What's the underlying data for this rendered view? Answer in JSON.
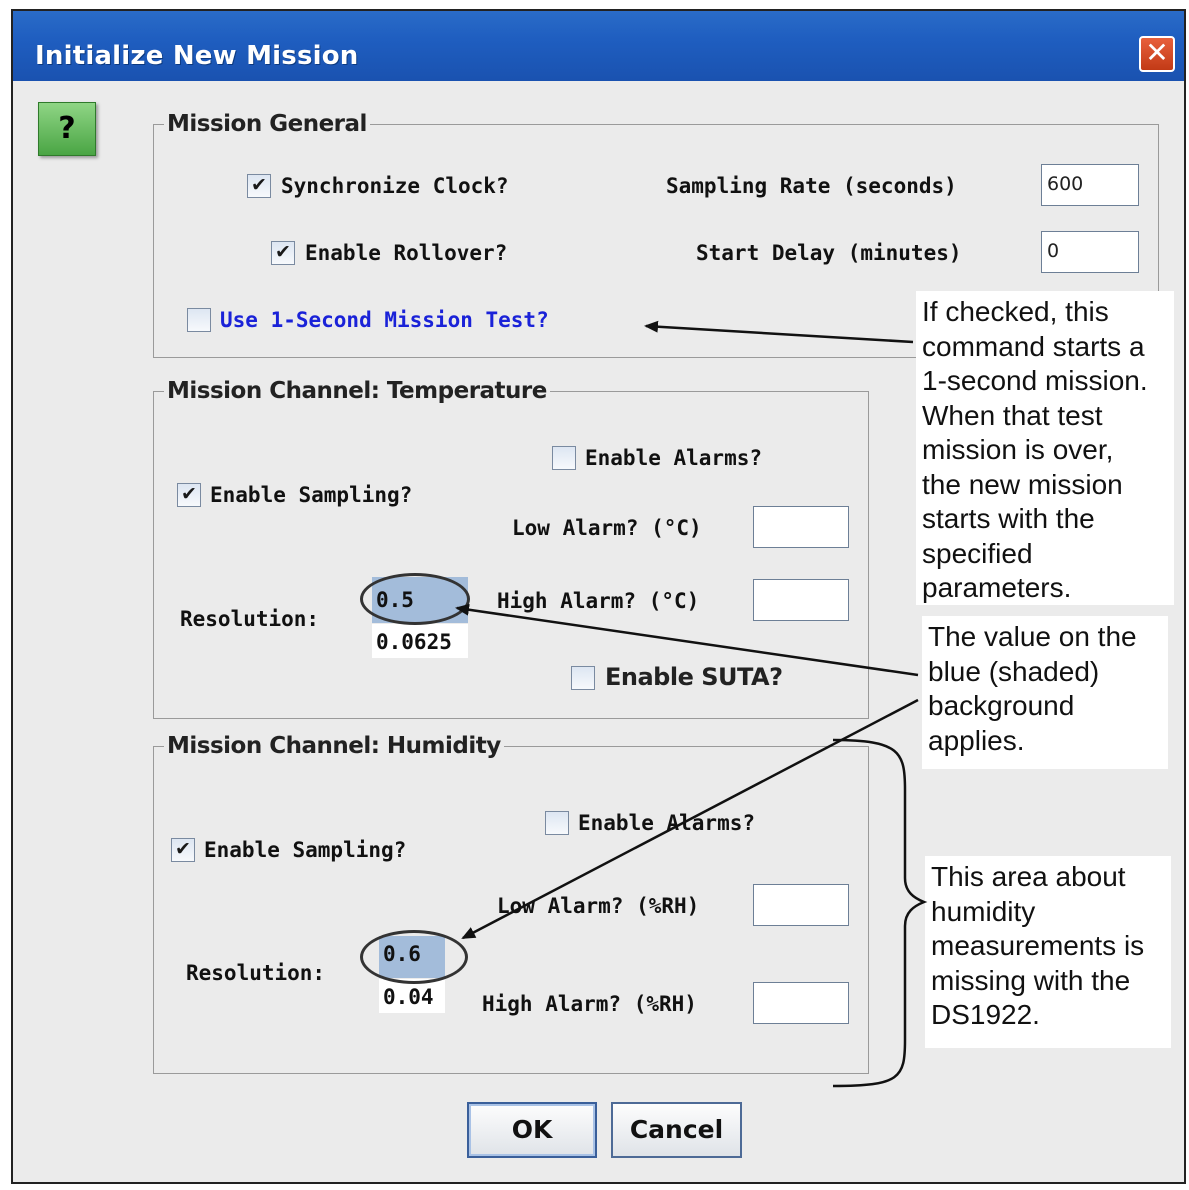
{
  "dialog": {
    "title": "Initialize New Mission",
    "close_symbol": "✕",
    "help_symbol": "?"
  },
  "general": {
    "title": "Mission General",
    "sync_clock": {
      "label": "Synchronize Clock?",
      "checked": true
    },
    "enable_rollover": {
      "label": "Enable Rollover?",
      "checked": true
    },
    "one_second_test": {
      "label": "Use 1-Second Mission Test?",
      "checked": false
    },
    "sampling_rate_label": "Sampling Rate (seconds)",
    "sampling_rate_value": "600",
    "start_delay_label": "Start Delay (minutes)",
    "start_delay_value": "0"
  },
  "temperature": {
    "title": "Mission Channel: Temperature",
    "enable_alarms": {
      "label": "Enable Alarms?",
      "checked": false
    },
    "enable_sampling": {
      "label": "Enable Sampling?",
      "checked": true
    },
    "low_alarm_label": "Low Alarm? (°C)",
    "low_alarm_value": "",
    "high_alarm_label": "High Alarm? (°C)",
    "high_alarm_value": "",
    "resolution_label": "Resolution:",
    "resolution_options": [
      "0.5",
      "0.0625"
    ],
    "enable_suta": {
      "label": "Enable SUTA?",
      "checked": false
    }
  },
  "humidity": {
    "title": "Mission Channel: Humidity",
    "enable_alarms": {
      "label": "Enable Alarms?",
      "checked": false
    },
    "enable_sampling": {
      "label": "Enable Sampling?",
      "checked": true
    },
    "low_alarm_label": "Low Alarm? (%RH)",
    "low_alarm_value": "",
    "high_alarm_label": "High Alarm? (%RH)",
    "high_alarm_value": "",
    "resolution_label": "Resolution:",
    "resolution_options": [
      "0.6",
      "0.04"
    ]
  },
  "buttons": {
    "ok": "OK",
    "cancel": "Cancel"
  },
  "callouts": {
    "test": [
      "If checked, this",
      "command starts a",
      "1-second mission.",
      "When that test",
      "mission is over,",
      "the new mission",
      "starts with the",
      "specified",
      "parameters."
    ],
    "shaded": [
      "The value on the",
      "blue (shaded)",
      "background",
      "applies."
    ],
    "humidity": [
      "This area about",
      "humidity",
      "measurements is",
      "missing with the",
      "DS1922."
    ]
  },
  "colors": {
    "titlebar": "#1f5ec0",
    "selection_shade": "#a3bcda",
    "link_text": "#1a22d8",
    "dialog_bg": "#ebebeb"
  }
}
